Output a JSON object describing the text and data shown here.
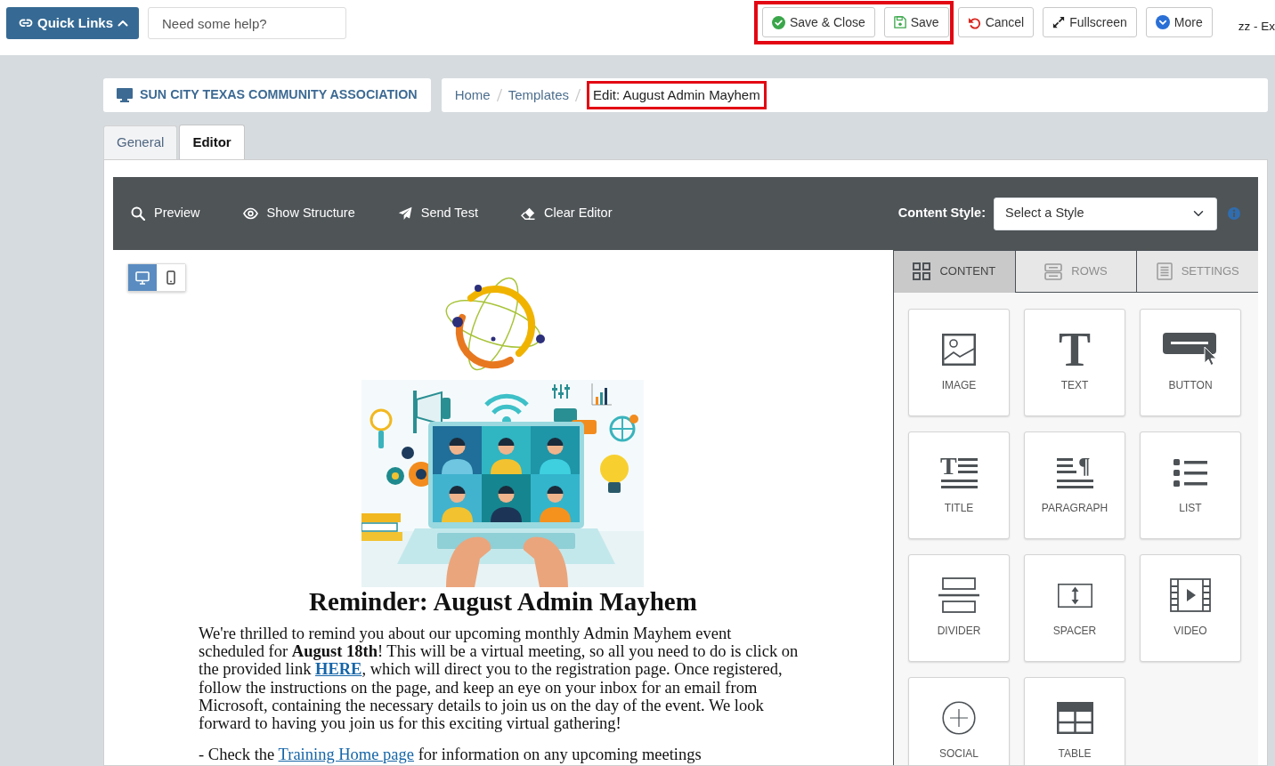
{
  "top_bar": {
    "quick_links": {
      "label": "Quick Links"
    },
    "help_field": {
      "placeholder": "Need some help?"
    },
    "button_groups": [
      {
        "highlighted": true,
        "buttons": [
          {
            "kind": "save_close",
            "label": "Save & Close"
          },
          {
            "kind": "save",
            "label": "Save"
          }
        ]
      },
      {
        "highlighted": false,
        "buttons": [
          {
            "kind": "cancel",
            "label": "Cancel"
          },
          {
            "kind": "fullscreen",
            "label": "Fullscreen"
          },
          {
            "kind": "more",
            "label": "More"
          }
        ]
      }
    ],
    "user": "zz - Ex"
  },
  "organization": {
    "name": "SUN CITY TEXAS COMMUNITY ASSOCIATION"
  },
  "breadcrumb": [
    {
      "label": "Home",
      "highlighted": false
    },
    {
      "label": "Templates",
      "highlighted": false
    },
    {
      "label": "Edit: August Admin Mayhem",
      "highlighted": true
    }
  ],
  "tabs": [
    {
      "label": "General",
      "selected": false
    },
    {
      "label": "Editor",
      "selected": true
    }
  ],
  "toolbar": {
    "actions": [
      {
        "kind": "preview",
        "label": "Preview"
      },
      {
        "kind": "structure",
        "label": "Show Structure"
      },
      {
        "kind": "send",
        "label": "Send Test"
      },
      {
        "kind": "clear",
        "label": "Clear Editor"
      }
    ],
    "content_style": {
      "label": "Content Style:",
      "value": "Select a Style"
    }
  },
  "device_toggle": [
    {
      "kind": "desktop",
      "selected": true
    },
    {
      "kind": "mobile",
      "selected": false
    }
  ],
  "email": {
    "title": "Reminder: August Admin Mayhem",
    "paragraphs": [
      {
        "parts": [
          {
            "kind": "text",
            "text": "We're thrilled to remind you about our upcoming monthly Admin Mayhem event scheduled for **August 18th**! This will be a virtual meeting, so all you need to do is click on the provided link "
          },
          {
            "kind": "link",
            "text": "HERE",
            "bold": true
          },
          {
            "kind": "text",
            "text": ", which will direct you to the registration page. Once registered, follow the instructions on the page, and keep an eye on your inbox for an email from Microsoft, containing the necessary details to join us on the day of the event. We look forward to having you join us for this exciting virtual gathering!"
          }
        ]
      },
      {
        "parts": [
          {
            "kind": "text",
            "text": "- Check the "
          },
          {
            "kind": "link",
            "text": "Training Home page",
            "bold": false
          },
          {
            "kind": "text",
            "text": " for information on any upcoming meetings"
          }
        ]
      }
    ]
  },
  "sidebar": {
    "tabs": [
      {
        "kind": "content",
        "label": "CONTENT",
        "selected": true
      },
      {
        "kind": "rows",
        "label": "ROWS",
        "selected": false
      },
      {
        "kind": "settings",
        "label": "SETTINGS",
        "selected": false
      }
    ],
    "blocks": [
      {
        "kind": "image",
        "label": "IMAGE"
      },
      {
        "kind": "text",
        "label": "TEXT",
        "glyph": "T"
      },
      {
        "kind": "button",
        "label": "BUTTON"
      },
      {
        "kind": "title",
        "label": "TITLE",
        "glyph": "T"
      },
      {
        "kind": "paragraph",
        "label": "PARAGRAPH",
        "glyph": "¶"
      },
      {
        "kind": "list",
        "label": "LIST"
      },
      {
        "kind": "divider",
        "label": "DIVIDER"
      },
      {
        "kind": "spacer",
        "label": "SPACER"
      },
      {
        "kind": "video",
        "label": "VIDEO"
      },
      {
        "kind": "social",
        "label": "SOCIAL"
      },
      {
        "kind": "table",
        "label": "TABLE"
      }
    ]
  }
}
